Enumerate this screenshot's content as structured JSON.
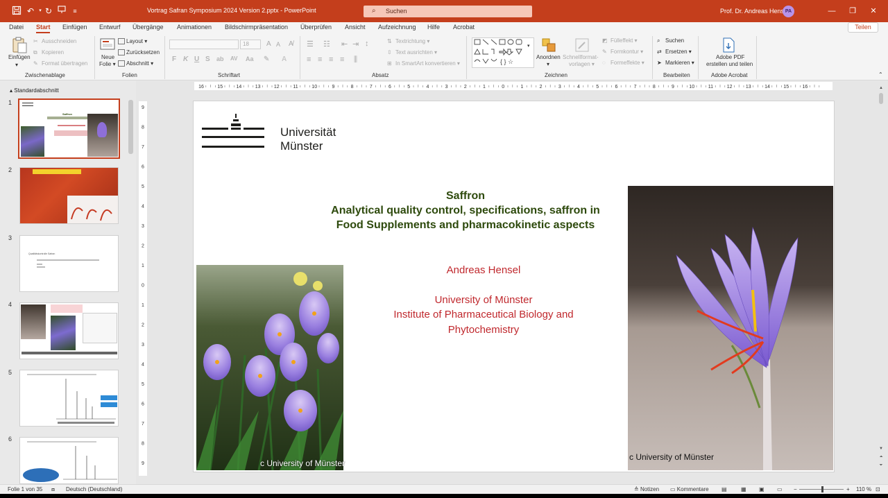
{
  "titlebar": {
    "doc_title": "Vortrag Safran Symposium  2024 Version 2.pptx  -  PowerPoint",
    "search_placeholder": "Suchen",
    "user_name": "Prof. Dr. Andreas Hensel",
    "user_initials": "PA",
    "color": "#c43e1c"
  },
  "tabs": [
    "Datei",
    "Start",
    "Einfügen",
    "Entwurf",
    "Übergänge",
    "Animationen",
    "Bildschirmpräsentation",
    "Überprüfen",
    "Ansicht",
    "Aufzeichnung",
    "Hilfe",
    "Acrobat"
  ],
  "active_tab": "Start",
  "share_label": "Teilen",
  "ribbon": {
    "clipboard": {
      "paste": "Einfügen",
      "cut": "Ausschneiden",
      "copy": "Kopieren",
      "format_painter": "Format übertragen",
      "group": "Zwischenablage"
    },
    "slides": {
      "new_slide_1": "Neue",
      "new_slide_2": "Folie",
      "layout": "Layout",
      "reset": "Zurücksetzen",
      "section": "Abschnitt",
      "group": "Folien"
    },
    "font": {
      "size": "18",
      "bold": "F",
      "italic": "K",
      "underline": "U",
      "strike": "S",
      "group": "Schriftart"
    },
    "paragraph": {
      "text_direction": "Textrichtung",
      "align_text": "Text ausrichten",
      "smartart": "In SmartArt konvertieren",
      "group": "Absatz"
    },
    "drawing": {
      "arrange": "Anordnen",
      "quick_styles_1": "Schnellformat-",
      "quick_styles_2": "vorlagen",
      "shape_fill": "Fülleffekt",
      "shape_outline": "Formkontur",
      "shape_effects": "Formeffekte",
      "group": "Zeichnen"
    },
    "editing": {
      "find": "Suchen",
      "replace": "Ersetzen",
      "select": "Markieren",
      "group": "Bearbeiten"
    },
    "acrobat": {
      "line1": "Adobe PDF",
      "line2": "erstellen und teilen",
      "group": "Adobe Acrobat"
    }
  },
  "slide_pane": {
    "section": "Standardabschnitt",
    "thumb_numbers": [
      "1",
      "2",
      "3",
      "4",
      "5",
      "6"
    ],
    "thumb1_title": "Saffron",
    "thumb3_text": "Qualitätskontrolle Safran"
  },
  "rulers": {
    "h": [
      "16",
      "15",
      "14",
      "13",
      "12",
      "11",
      "10",
      "9",
      "8",
      "7",
      "6",
      "5",
      "4",
      "3",
      "2",
      "1",
      "0",
      "1",
      "2",
      "3",
      "4",
      "5",
      "6",
      "7",
      "8",
      "9",
      "10",
      "11",
      "12",
      "13",
      "14",
      "15",
      "16"
    ],
    "v": [
      "9",
      "8",
      "7",
      "6",
      "5",
      "4",
      "3",
      "2",
      "1",
      "0",
      "1",
      "2",
      "3",
      "4",
      "5",
      "6",
      "7",
      "8",
      "9"
    ]
  },
  "slide": {
    "uni_name_line1": "Universität",
    "uni_name_line2": "Münster",
    "title_line1": "Saffron",
    "title_line2": "Analytical quality control, specifications, saffron in",
    "title_line3": "Food Supplements and pharmacokinetic aspects",
    "author": "Andreas Hensel",
    "affiliation_line1": "University of Münster",
    "affiliation_line2": "Institute of Pharmaceutical Biology and",
    "affiliation_line3": "Phytochemistry",
    "credit_left": "c University of Münster",
    "credit_right": "c University of Münster",
    "title_color": "#2e4a0d",
    "text_color": "#c0282d"
  },
  "statusbar": {
    "slide_info": "Folie 1 von 35",
    "language": "Deutsch (Deutschland)",
    "notes": "Notizen",
    "comments": "Kommentare",
    "zoom": "110 %",
    "minus": "−",
    "plus": "+"
  }
}
